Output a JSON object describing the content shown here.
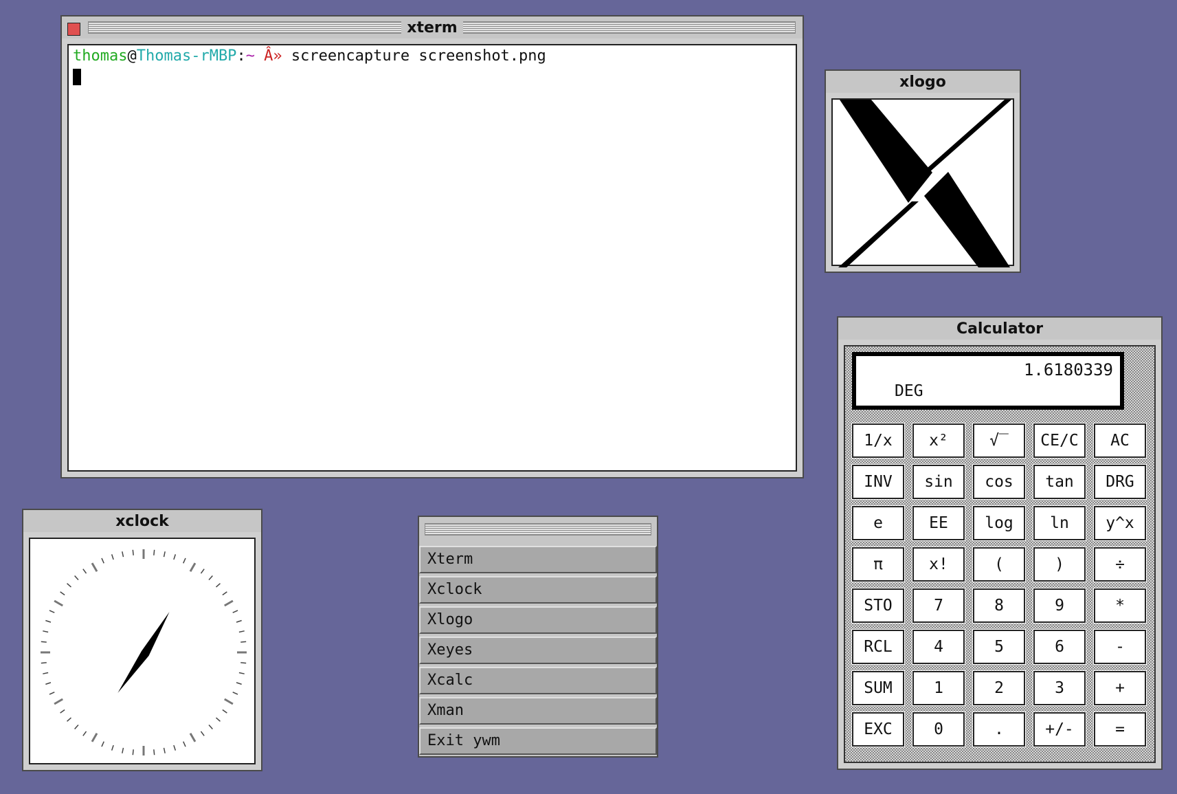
{
  "xterm": {
    "title": "xterm",
    "prompt_user": "thomas",
    "prompt_at": "@",
    "prompt_host": "Thomas-rMBP",
    "prompt_colon": ":",
    "prompt_dir": "~",
    "prompt_symbol": " Â» ",
    "command": "screencapture screenshot.png"
  },
  "xlogo": {
    "title": "xlogo"
  },
  "xclock": {
    "title": "xclock",
    "time": {
      "hour": 1,
      "minute": 5
    }
  },
  "menu": {
    "items": [
      {
        "label": "Xterm"
      },
      {
        "label": "Xclock"
      },
      {
        "label": "Xlogo"
      },
      {
        "label": "Xeyes"
      },
      {
        "label": "Xcalc"
      },
      {
        "label": "Xman"
      },
      {
        "label": "Exit ywm"
      }
    ]
  },
  "calculator": {
    "title": "Calculator",
    "display_value": "1.6180339",
    "angle_mode": "DEG",
    "buttons": [
      [
        "1/x",
        "x²",
        "√‾",
        "CE/C",
        "AC"
      ],
      [
        "INV",
        "sin",
        "cos",
        "tan",
        "DRG"
      ],
      [
        "e",
        "EE",
        "log",
        "ln",
        "y^x"
      ],
      [
        "π",
        "x!",
        "(",
        ")",
        "÷"
      ],
      [
        "STO",
        "7",
        "8",
        "9",
        "*"
      ],
      [
        "RCL",
        "4",
        "5",
        "6",
        "-"
      ],
      [
        "SUM",
        "1",
        "2",
        "3",
        "+"
      ],
      [
        "EXC",
        "0",
        ".",
        "+/-",
        "="
      ]
    ]
  }
}
